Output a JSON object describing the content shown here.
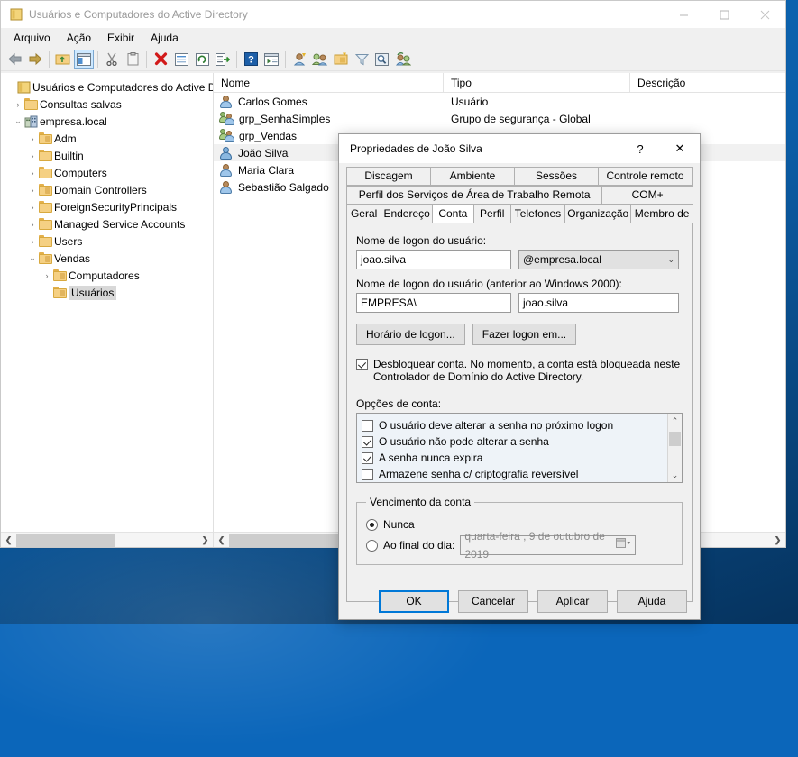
{
  "window": {
    "title": "Usuários e Computadores do Active Directory",
    "icon": "mmc-console-icon",
    "controls": {
      "minimize": "minimize-icon",
      "maximize": "maximize-icon",
      "close": "close-icon"
    }
  },
  "menubar": {
    "items": [
      "Arquivo",
      "Ação",
      "Exibir",
      "Ajuda"
    ]
  },
  "toolbar": {
    "items": [
      {
        "name": "back-icon"
      },
      {
        "name": "forward-icon"
      },
      {
        "name": "separator"
      },
      {
        "name": "up-folder-icon"
      },
      {
        "name": "show-console-tree-icon",
        "selected": true
      },
      {
        "name": "separator"
      },
      {
        "name": "cut-icon"
      },
      {
        "name": "copy-icon"
      },
      {
        "name": "separator"
      },
      {
        "name": "delete-icon"
      },
      {
        "name": "properties-icon"
      },
      {
        "name": "refresh-icon"
      },
      {
        "name": "export-list-icon"
      },
      {
        "name": "separator"
      },
      {
        "name": "help-icon"
      },
      {
        "name": "show-action-pane-icon"
      },
      {
        "name": "separator"
      },
      {
        "name": "new-user-icon"
      },
      {
        "name": "new-group-icon"
      },
      {
        "name": "new-ou-icon"
      },
      {
        "name": "filter-icon"
      },
      {
        "name": "find-icon"
      },
      {
        "name": "saved-query-icon"
      }
    ]
  },
  "tree": {
    "nodes": [
      {
        "label": "Usuários e Computadores do Active Dir",
        "icon": "console-root-icon",
        "indent": 0,
        "chevron": "",
        "selected": false
      },
      {
        "label": "Consultas salvas",
        "icon": "folder-icon",
        "indent": 1,
        "chevron": "›",
        "selected": false
      },
      {
        "label": "empresa.local",
        "icon": "domain-icon",
        "indent": 1,
        "chevron": "⌄",
        "selected": false
      },
      {
        "label": "Adm",
        "icon": "ou-icon",
        "indent": 2,
        "chevron": "›",
        "selected": false
      },
      {
        "label": "Builtin",
        "icon": "folder-icon",
        "indent": 2,
        "chevron": "›",
        "selected": false
      },
      {
        "label": "Computers",
        "icon": "folder-icon",
        "indent": 2,
        "chevron": "›",
        "selected": false
      },
      {
        "label": "Domain Controllers",
        "icon": "ou-icon",
        "indent": 2,
        "chevron": "›",
        "selected": false
      },
      {
        "label": "ForeignSecurityPrincipals",
        "icon": "folder-icon",
        "indent": 2,
        "chevron": "›",
        "selected": false
      },
      {
        "label": "Managed Service Accounts",
        "icon": "folder-icon",
        "indent": 2,
        "chevron": "›",
        "selected": false
      },
      {
        "label": "Users",
        "icon": "folder-icon",
        "indent": 2,
        "chevron": "›",
        "selected": false
      },
      {
        "label": "Vendas",
        "icon": "ou-icon",
        "indent": 2,
        "chevron": "⌄",
        "selected": false
      },
      {
        "label": "Computadores",
        "icon": "ou-icon",
        "indent": 3,
        "chevron": "›",
        "selected": false
      },
      {
        "label": "Usuários",
        "icon": "ou-icon",
        "indent": 3,
        "chevron": "",
        "selected": true
      }
    ]
  },
  "listview": {
    "columns": [
      "Nome",
      "Tipo",
      "Descrição"
    ],
    "rows": [
      {
        "nome": "Carlos Gomes",
        "tipo": "Usuário",
        "descricao": "",
        "icon": "user-icon",
        "selected": false
      },
      {
        "nome": "grp_SenhaSimples",
        "tipo": "Grupo de segurança - Global",
        "descricao": "",
        "icon": "group-icon",
        "selected": false
      },
      {
        "nome": "grp_Vendas",
        "tipo": "",
        "descricao": "",
        "icon": "group-icon",
        "selected": false
      },
      {
        "nome": "João Silva",
        "tipo": "",
        "descricao": "",
        "icon": "user-icon-selected",
        "selected": true
      },
      {
        "nome": "Maria Clara",
        "tipo": "",
        "descricao": "",
        "icon": "user-icon",
        "selected": false
      },
      {
        "nome": "Sebastião Salgado",
        "tipo": "",
        "descricao": "",
        "icon": "user-icon",
        "selected": false
      }
    ]
  },
  "dialog": {
    "title": "Propriedades de João Silva",
    "help_label": "?",
    "close_label": "✕",
    "tabs_row1": [
      "Discagem",
      "Ambiente",
      "Sessões",
      "Controle remoto"
    ],
    "tabs_row2": [
      "Perfil dos Serviços de Área de Trabalho Remota",
      "COM+"
    ],
    "tabs_row3": [
      "Geral",
      "Endereço",
      "Conta",
      "Perfil",
      "Telefones",
      "Organização",
      "Membro de"
    ],
    "active_tab": "Conta",
    "account": {
      "logon_label": "Nome de logon do usuário:",
      "logon_value": "joao.silva",
      "upn_suffix": "@empresa.local",
      "pre2000_label": "Nome de logon do usuário (anterior ao Windows 2000):",
      "pre2000_domain": "EMPRESA\\",
      "pre2000_value": "joao.silva",
      "logon_hours_button": "Horário de logon...",
      "logon_to_button": "Fazer logon em...",
      "unlock_text": "Desbloquear conta. No momento, a conta está bloqueada neste Controlador de Domínio do Active Directory.",
      "unlock_checked": true,
      "options_label": "Opções de conta:",
      "options": [
        {
          "label": "O usuário deve alterar a senha no próximo logon",
          "checked": false
        },
        {
          "label": "O usuário não pode alterar a senha",
          "checked": true
        },
        {
          "label": "A senha nunca expira",
          "checked": true
        },
        {
          "label": "Armazene senha c/ criptografia reversível",
          "checked": false
        }
      ],
      "expiration": {
        "legend": "Vencimento da conta",
        "never_label": "Nunca",
        "never_selected": true,
        "end_of_label": "Ao final do dia:",
        "end_of_selected": false,
        "date_value": "quarta-feira ,  9 de  outubro  de 2019"
      }
    },
    "buttons": [
      "OK",
      "Cancelar",
      "Aplicar",
      "Ajuda"
    ],
    "default_button": "OK"
  },
  "colors": {
    "accent": "#0078d7",
    "desktop": "#0b66ba",
    "selection": "#d8d8d8",
    "listbox_bg": "#eef3f8"
  }
}
